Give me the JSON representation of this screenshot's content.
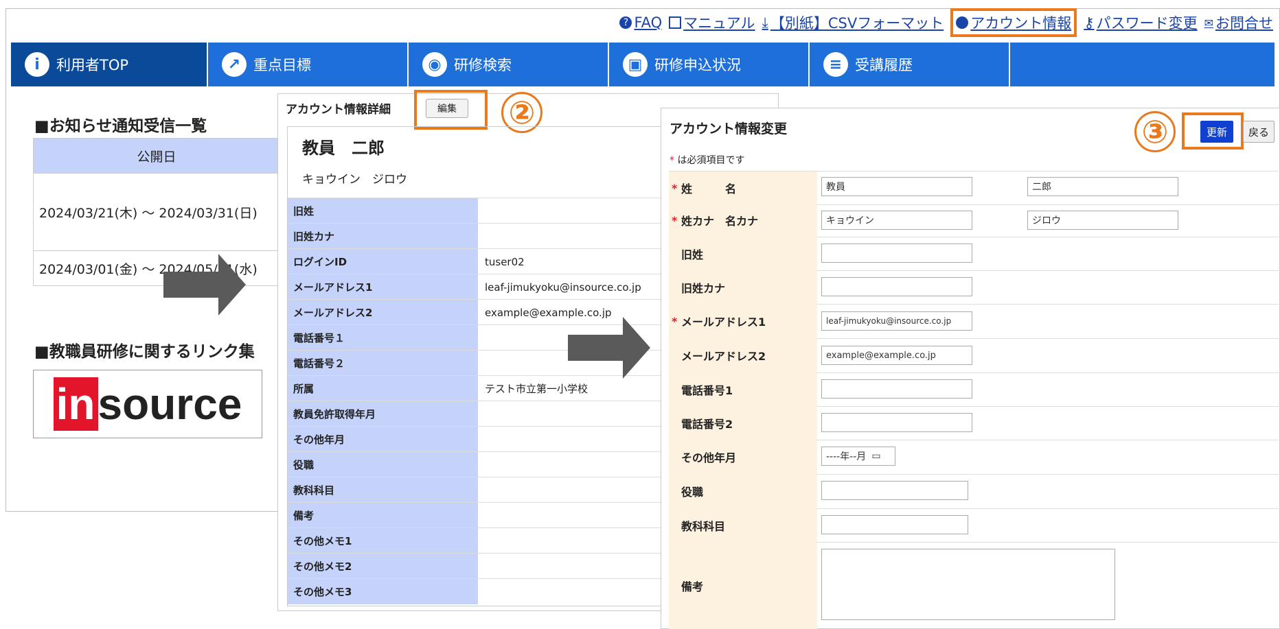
{
  "toplinks": {
    "faq": "FAQ",
    "manual": "マニュアル",
    "csv": "【別紙】CSVフォーマット",
    "account": "アカウント情報",
    "password": "パスワード変更",
    "contact": "お問合せ"
  },
  "nav": [
    "利用者TOP",
    "重点目標",
    "研修検索",
    "研修申込状況",
    "受講履歴"
  ],
  "news": {
    "heading": "■お知らせ通知受信一覧",
    "column": "公開日",
    "rows": [
      "2024/03/21(木) ～ 2024/03/31(日)",
      "2024/03/01(金) ～ 2024/05/01(水)"
    ]
  },
  "links_heading": "■教職員研修に関するリンク集",
  "logo": {
    "red": "in",
    "dark": "source"
  },
  "steps": {
    "two": "②",
    "three": "③"
  },
  "detail": {
    "title": "アカウント情報詳細",
    "edit": "編集",
    "name": "教員　二郎",
    "kana": "キョウイン　ジロウ",
    "rows": [
      {
        "label": "旧姓",
        "value": ""
      },
      {
        "label": "旧姓カナ",
        "value": ""
      },
      {
        "label": "ログインID",
        "value": "tuser02"
      },
      {
        "label": "メールアドレス1",
        "value": "leaf-jimukyoku@insource.co.jp"
      },
      {
        "label": "メールアドレス2",
        "value": "example@example.co.jp"
      },
      {
        "label": "電話番号１",
        "value": ""
      },
      {
        "label": "電話番号２",
        "value": ""
      },
      {
        "label": "所属",
        "value": "テスト市立第一小学校"
      },
      {
        "label": "教員免許取得年月",
        "value": ""
      },
      {
        "label": "その他年月",
        "value": ""
      },
      {
        "label": "役職",
        "value": ""
      },
      {
        "label": "教科科目",
        "value": ""
      },
      {
        "label": "備考",
        "value": ""
      },
      {
        "label": "その他メモ1",
        "value": ""
      },
      {
        "label": "その他メモ2",
        "value": ""
      },
      {
        "label": "その他メモ3",
        "value": ""
      }
    ]
  },
  "form": {
    "title": "アカウント情報変更",
    "update": "更新",
    "back": "戻る",
    "required_note": "は必須項目です",
    "required_mark": "*",
    "rows": {
      "name": {
        "label": "姓　　　名",
        "v1": "教員",
        "v2": "二郎"
      },
      "kana": {
        "label": "姓カナ　名カナ",
        "v1": "キョウイン",
        "v2": "ジロウ"
      },
      "kyusei": {
        "label": "旧姓",
        "v1": ""
      },
      "kyusei_kana": {
        "label": "旧姓カナ",
        "v1": ""
      },
      "mail1": {
        "label": "メールアドレス1",
        "v1": "leaf-jimukyoku@insource.co.jp"
      },
      "mail2": {
        "label": "メールアドレス2",
        "v1": "example@example.co.jp"
      },
      "tel1": {
        "label": "電話番号1",
        "v1": ""
      },
      "tel2": {
        "label": "電話番号2",
        "v1": ""
      },
      "other_ym": {
        "label": "その他年月",
        "v1": "----年--月"
      },
      "position": {
        "label": "役職",
        "v1": ""
      },
      "subject": {
        "label": "教科科目",
        "v1": ""
      },
      "memo": {
        "label": "備考",
        "v1": ""
      }
    }
  },
  "colors": {
    "accent": "#e8791c",
    "nav": "#1e6fd9",
    "nav_active": "#0b4a99",
    "header_cell": "#c5d3fb",
    "label_cell": "#fdf1e0",
    "update_btn": "#1040d0"
  }
}
